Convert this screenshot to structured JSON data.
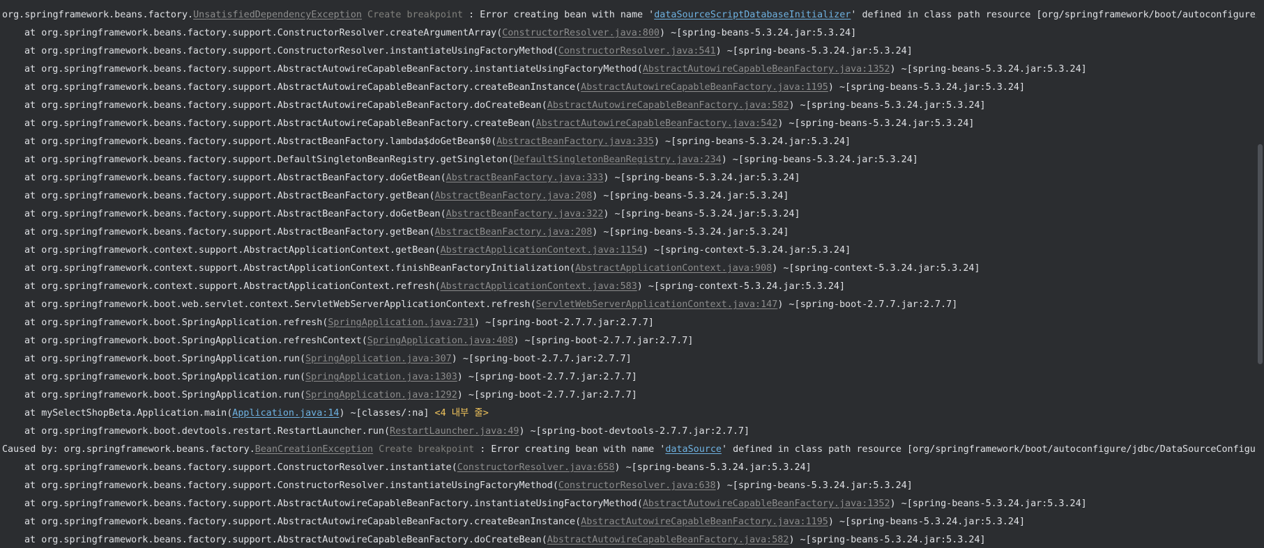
{
  "exception_header": {
    "prefix": "org.springframework.beans.factory.",
    "exception": "UnsatisfiedDependencyException",
    "breakpoint_label": "Create breakpoint",
    "message_start": " : Error creating bean with name '",
    "bean": "dataSourceScriptDatabaseInitializer",
    "message_end": "' defined in class path resource [org/springframework/boot/autoconfigure/sql/init/DataSourceInitializationConfiguration.class]"
  },
  "frames": [
    {
      "method": "org.springframework.beans.factory.support.ConstructorResolver.createArgumentArray",
      "source": "ConstructorResolver.java:800",
      "jar": "spring-beans-5.3.24.jar:5.3.24"
    },
    {
      "method": "org.springframework.beans.factory.support.ConstructorResolver.instantiateUsingFactoryMethod",
      "source": "ConstructorResolver.java:541",
      "jar": "spring-beans-5.3.24.jar:5.3.24"
    },
    {
      "method": "org.springframework.beans.factory.support.AbstractAutowireCapableBeanFactory.instantiateUsingFactoryMethod",
      "source": "AbstractAutowireCapableBeanFactory.java:1352",
      "jar": "spring-beans-5.3.24.jar:5.3.24"
    },
    {
      "method": "org.springframework.beans.factory.support.AbstractAutowireCapableBeanFactory.createBeanInstance",
      "source": "AbstractAutowireCapableBeanFactory.java:1195",
      "jar": "spring-beans-5.3.24.jar:5.3.24"
    },
    {
      "method": "org.springframework.beans.factory.support.AbstractAutowireCapableBeanFactory.doCreateBean",
      "source": "AbstractAutowireCapableBeanFactory.java:582",
      "jar": "spring-beans-5.3.24.jar:5.3.24"
    },
    {
      "method": "org.springframework.beans.factory.support.AbstractAutowireCapableBeanFactory.createBean",
      "source": "AbstractAutowireCapableBeanFactory.java:542",
      "jar": "spring-beans-5.3.24.jar:5.3.24"
    },
    {
      "method": "org.springframework.beans.factory.support.AbstractBeanFactory.lambda$doGetBean$0",
      "source": "AbstractBeanFactory.java:335",
      "jar": "spring-beans-5.3.24.jar:5.3.24"
    },
    {
      "method": "org.springframework.beans.factory.support.DefaultSingletonBeanRegistry.getSingleton",
      "source": "DefaultSingletonBeanRegistry.java:234",
      "jar": "spring-beans-5.3.24.jar:5.3.24"
    },
    {
      "method": "org.springframework.beans.factory.support.AbstractBeanFactory.doGetBean",
      "source": "AbstractBeanFactory.java:333",
      "jar": "spring-beans-5.3.24.jar:5.3.24"
    },
    {
      "method": "org.springframework.beans.factory.support.AbstractBeanFactory.getBean",
      "source": "AbstractBeanFactory.java:208",
      "jar": "spring-beans-5.3.24.jar:5.3.24"
    },
    {
      "method": "org.springframework.beans.factory.support.AbstractBeanFactory.doGetBean",
      "source": "AbstractBeanFactory.java:322",
      "jar": "spring-beans-5.3.24.jar:5.3.24"
    },
    {
      "method": "org.springframework.beans.factory.support.AbstractBeanFactory.getBean",
      "source": "AbstractBeanFactory.java:208",
      "jar": "spring-beans-5.3.24.jar:5.3.24"
    },
    {
      "method": "org.springframework.context.support.AbstractApplicationContext.getBean",
      "source": "AbstractApplicationContext.java:1154",
      "jar": "spring-context-5.3.24.jar:5.3.24"
    },
    {
      "method": "org.springframework.context.support.AbstractApplicationContext.finishBeanFactoryInitialization",
      "source": "AbstractApplicationContext.java:908",
      "jar": "spring-context-5.3.24.jar:5.3.24"
    },
    {
      "method": "org.springframework.context.support.AbstractApplicationContext.refresh",
      "source": "AbstractApplicationContext.java:583",
      "jar": "spring-context-5.3.24.jar:5.3.24"
    },
    {
      "method": "org.springframework.boot.web.servlet.context.ServletWebServerApplicationContext.refresh",
      "source": "ServletWebServerApplicationContext.java:147",
      "jar": "spring-boot-2.7.7.jar:2.7.7"
    },
    {
      "method": "org.springframework.boot.SpringApplication.refresh",
      "source": "SpringApplication.java:731",
      "jar": "spring-boot-2.7.7.jar:2.7.7"
    },
    {
      "method": "org.springframework.boot.SpringApplication.refreshContext",
      "source": "SpringApplication.java:408",
      "jar": "spring-boot-2.7.7.jar:2.7.7"
    },
    {
      "method": "org.springframework.boot.SpringApplication.run",
      "source": "SpringApplication.java:307",
      "jar": "spring-boot-2.7.7.jar:2.7.7"
    },
    {
      "method": "org.springframework.boot.SpringApplication.run",
      "source": "SpringApplication.java:1303",
      "jar": "spring-boot-2.7.7.jar:2.7.7"
    },
    {
      "method": "org.springframework.boot.SpringApplication.run",
      "source": "SpringApplication.java:1292",
      "jar": "spring-boot-2.7.7.jar:2.7.7"
    },
    {
      "method": "mySelectShopBeta.Application.main",
      "source": "Application.java:14",
      "jar": "classes/:na",
      "user_code": true,
      "hidden_frames": "<4 내부 줄>"
    },
    {
      "method": "org.springframework.boot.devtools.restart.RestartLauncher.run",
      "source": "RestartLauncher.java:49",
      "jar": "spring-boot-devtools-2.7.7.jar:2.7.7"
    }
  ],
  "caused_by": {
    "prefix": "Caused by: org.springframework.beans.factory.",
    "exception": "BeanCreationException",
    "breakpoint_label": "Create breakpoint",
    "message_start": " : Error creating bean with name '",
    "bean": "dataSource",
    "message_end": "' defined in class path resource [org/springframework/boot/autoconfigure/jdbc/DataSourceConfiguration$Hikari.class]"
  },
  "caused_frames": [
    {
      "method": "org.springframework.beans.factory.support.ConstructorResolver.instantiate",
      "source": "ConstructorResolver.java:658",
      "jar": "spring-beans-5.3.24.jar:5.3.24"
    },
    {
      "method": "org.springframework.beans.factory.support.ConstructorResolver.instantiateUsingFactoryMethod",
      "source": "ConstructorResolver.java:638",
      "jar": "spring-beans-5.3.24.jar:5.3.24"
    },
    {
      "method": "org.springframework.beans.factory.support.AbstractAutowireCapableBeanFactory.instantiateUsingFactoryMethod",
      "source": "AbstractAutowireCapableBeanFactory.java:1352",
      "jar": "spring-beans-5.3.24.jar:5.3.24"
    },
    {
      "method": "org.springframework.beans.factory.support.AbstractAutowireCapableBeanFactory.createBeanInstance",
      "source": "AbstractAutowireCapableBeanFactory.java:1195",
      "jar": "spring-beans-5.3.24.jar:5.3.24"
    },
    {
      "method": "org.springframework.beans.factory.support.AbstractAutowireCapableBeanFactory.doCreateBean",
      "source": "AbstractAutowireCapableBeanFactory.java:582",
      "jar": "spring-beans-5.3.24.jar:5.3.24"
    }
  ]
}
